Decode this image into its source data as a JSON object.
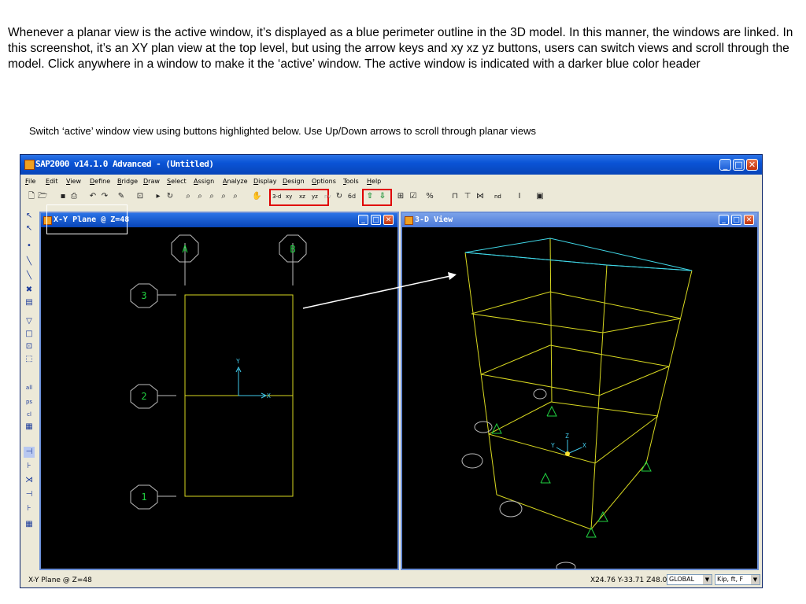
{
  "intro": {
    "paragraph": "Whenever a planar view is the active window, it’s displayed as a blue perimeter outline in the 3D model. In this manner, the windows are linked. In this screenshot, it’s an XY plan view at the top level, but using the arrow keys and xy xz yz buttons, users can switch views and scroll through the model. Click anywhere in a window to make it the ‘active’ window. The active window is indicated with a darker blue color header",
    "instruction": "Switch ‘active’ window view using buttons highlighted below. Use Up/Down arrows to scroll through planar views"
  },
  "app": {
    "title": "SAP2000 v14.1.0 Advanced  - (Untitled)",
    "menu": [
      "File",
      "Edit",
      "View",
      "Define",
      "Bridge",
      "Draw",
      "Select",
      "Assign",
      "Analyze",
      "Display",
      "Design",
      "Options",
      "Tools",
      "Help"
    ],
    "toolbar": {
      "view_buttons": [
        "3-d",
        "xy",
        "xz",
        "yz",
        "nv"
      ],
      "zoom_label": "nd"
    },
    "left_pane": {
      "title": "X-Y Plane @ Z=48",
      "grid_letters": [
        "A",
        "B"
      ],
      "grid_numbers": [
        "3",
        "2",
        "1"
      ],
      "axis_y": "Y",
      "axis_x": "X"
    },
    "right_pane": {
      "title": "3-D View",
      "axis_labels": [
        "Z",
        "Y",
        "X"
      ]
    },
    "status": {
      "left": "X-Y Plane @ Z=48",
      "coords": "X24.76  Y-33.71  Z48.00",
      "coord_system": "GLOBAL",
      "units": "Kip, ft, F"
    }
  },
  "colors": {
    "title_blue": "#0a54d6",
    "grid_yellow": "#d8d820",
    "grid_green": "#20d040",
    "active_outline": "#40d8e8",
    "highlight_red": "#e00000"
  }
}
